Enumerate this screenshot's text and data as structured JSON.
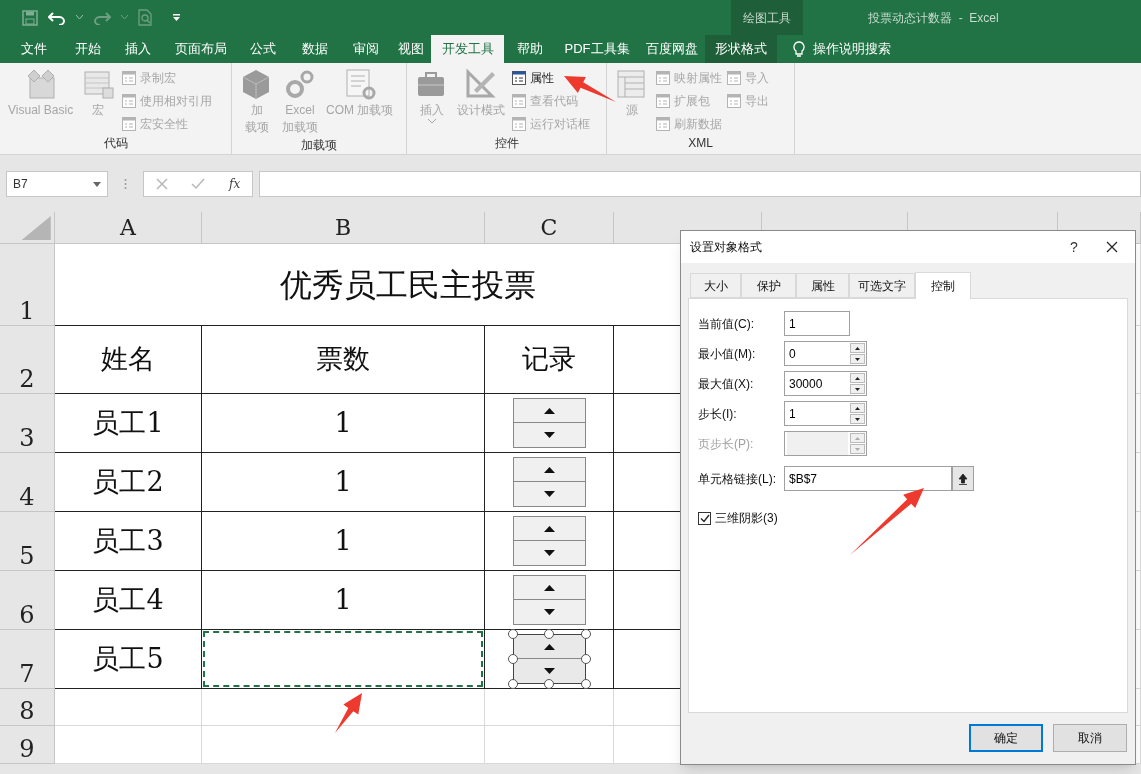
{
  "title_bar": {
    "context_group": "绘图工具",
    "title": "投票动态计数器  -  Excel"
  },
  "ribbon_tabs": [
    {
      "label": "文件",
      "selected": false,
      "contextual": false
    },
    {
      "label": "开始",
      "selected": false,
      "contextual": false
    },
    {
      "label": "插入",
      "selected": false,
      "contextual": false
    },
    {
      "label": "页面布局",
      "selected": false,
      "contextual": false
    },
    {
      "label": "公式",
      "selected": false,
      "contextual": false
    },
    {
      "label": "数据",
      "selected": false,
      "contextual": false
    },
    {
      "label": "审阅",
      "selected": false,
      "contextual": false
    },
    {
      "label": "视图",
      "selected": false,
      "contextual": false
    },
    {
      "label": "开发工具",
      "selected": true,
      "contextual": false
    },
    {
      "label": "帮助",
      "selected": false,
      "contextual": false
    },
    {
      "label": "PDF工具集",
      "selected": false,
      "contextual": false
    },
    {
      "label": "百度网盘",
      "selected": false,
      "contextual": false
    },
    {
      "label": "形状格式",
      "selected": false,
      "contextual": true
    }
  ],
  "tell_me": "操作说明搜索",
  "ribbon_groups": [
    {
      "label": "代码",
      "items": [
        {
          "kind": "large",
          "lines": [
            "Visual Basic"
          ],
          "disabled": true
        },
        {
          "kind": "large",
          "lines": [
            "宏"
          ],
          "disabled": true
        },
        {
          "kind": "column",
          "items": [
            {
              "label": "录制宏",
              "disabled": true
            },
            {
              "label": "使用相对引用",
              "disabled": true
            },
            {
              "label": "宏安全性",
              "disabled": true
            }
          ]
        }
      ]
    },
    {
      "label": "加载项",
      "items": [
        {
          "kind": "large",
          "lines": [
            "加",
            "载项"
          ],
          "disabled": true
        },
        {
          "kind": "large",
          "lines": [
            "Excel",
            "加载项"
          ],
          "disabled": true
        },
        {
          "kind": "large",
          "lines": [
            "COM 加载项"
          ],
          "disabled": true
        }
      ]
    },
    {
      "label": "控件",
      "items": [
        {
          "kind": "large",
          "lines": [
            "插入"
          ],
          "disabled": true,
          "dropdown": true
        },
        {
          "kind": "large",
          "lines": [
            "设计模式"
          ],
          "disabled": true
        },
        {
          "kind": "column",
          "items": [
            {
              "label": "属性",
              "disabled": false
            },
            {
              "label": "查看代码",
              "disabled": true
            },
            {
              "label": "运行对话框",
              "disabled": true
            }
          ]
        }
      ]
    },
    {
      "label": "XML",
      "items": [
        {
          "kind": "large",
          "lines": [
            "源"
          ],
          "disabled": true
        },
        {
          "kind": "column",
          "items": [
            {
              "label": "映射属性",
              "disabled": true
            },
            {
              "label": "扩展包",
              "disabled": true
            },
            {
              "label": "刷新数据",
              "disabled": true
            }
          ]
        },
        {
          "kind": "column",
          "items": [
            {
              "label": "导入",
              "disabled": true
            },
            {
              "label": "导出",
              "disabled": true
            }
          ]
        }
      ]
    }
  ],
  "formula_bar": {
    "name_box": "B7",
    "fx": "fx"
  },
  "sheet": {
    "columns": [
      "A",
      "B",
      "C"
    ],
    "rows": [
      {
        "number": "1",
        "title": "优秀员工民主投票"
      },
      {
        "number": "2",
        "cells": {
          "A": "姓名",
          "B": "票数",
          "C": "记录"
        }
      },
      {
        "number": "3",
        "cells": {
          "A": "员工1",
          "B": "1"
        },
        "spinner": {
          "selected": false
        }
      },
      {
        "number": "4",
        "cells": {
          "A": "员工2",
          "B": "1"
        },
        "spinner": {
          "selected": false
        }
      },
      {
        "number": "5",
        "cells": {
          "A": "员工3",
          "B": "1"
        },
        "spinner": {
          "selected": false
        }
      },
      {
        "number": "6",
        "cells": {
          "A": "员工4",
          "B": "1"
        },
        "spinner": {
          "selected": false
        }
      },
      {
        "number": "7",
        "cells": {
          "A": "员工5"
        },
        "spinner": {
          "selected": true
        },
        "marquee": true
      },
      {
        "number": "8"
      },
      {
        "number": "9"
      }
    ]
  },
  "dialog": {
    "title": "设置对象格式",
    "help": "?",
    "tabs": [
      {
        "label": "大小",
        "selected": false
      },
      {
        "label": "保护",
        "selected": false
      },
      {
        "label": "属性",
        "selected": false
      },
      {
        "label": "可选文字",
        "selected": false
      },
      {
        "label": "控制",
        "selected": true
      }
    ],
    "fields": [
      {
        "label": "当前值(C):",
        "kind": "text",
        "value": "1",
        "disabled": false
      },
      {
        "label": "最小值(M):",
        "kind": "spin",
        "value": "0",
        "disabled": false
      },
      {
        "label": "最大值(X):",
        "kind": "spin",
        "value": "30000",
        "disabled": false
      },
      {
        "label": "步长(I):",
        "kind": "spin",
        "value": "1",
        "disabled": false
      },
      {
        "label": "页步长(P):",
        "kind": "spin",
        "disabled": true
      },
      {
        "label": "单元格链接(L):",
        "kind": "link",
        "value": "$B$7",
        "disabled": false
      }
    ],
    "checkbox": {
      "label": "三维阴影(3)",
      "checked": true
    },
    "buttons": [
      {
        "label": "确定",
        "default": true
      },
      {
        "label": "取消",
        "default": false
      }
    ]
  }
}
